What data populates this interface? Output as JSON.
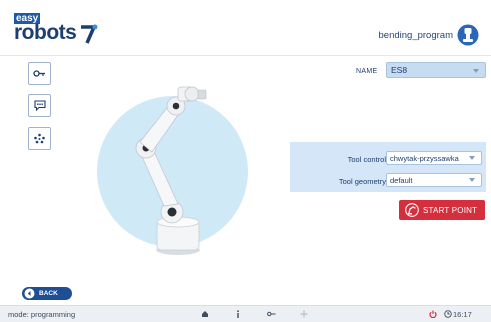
{
  "header": {
    "logo_top": "easy",
    "logo_bottom": "robots",
    "program_name": "bending_program"
  },
  "form": {
    "name_label": "NAME",
    "name_value": "ES8",
    "tool_control_label": "Tool control",
    "tool_control_value": "chwytak-przyssawka",
    "tool_geometry_label": "Tool geometry",
    "tool_geometry_value": "default",
    "start_point_label": "START POINT"
  },
  "footer": {
    "back_label": "BACK",
    "mode_text": "mode: programming",
    "time": "16:17"
  },
  "sidebar_tools": [
    "key-icon",
    "chat-icon",
    "dots-icon"
  ],
  "colors": {
    "brand_blue": "#1e5aa8",
    "accent_red": "#d52f3e",
    "panel_blue": "#d4e6f7",
    "circle_blue": "#cfe9f7"
  }
}
